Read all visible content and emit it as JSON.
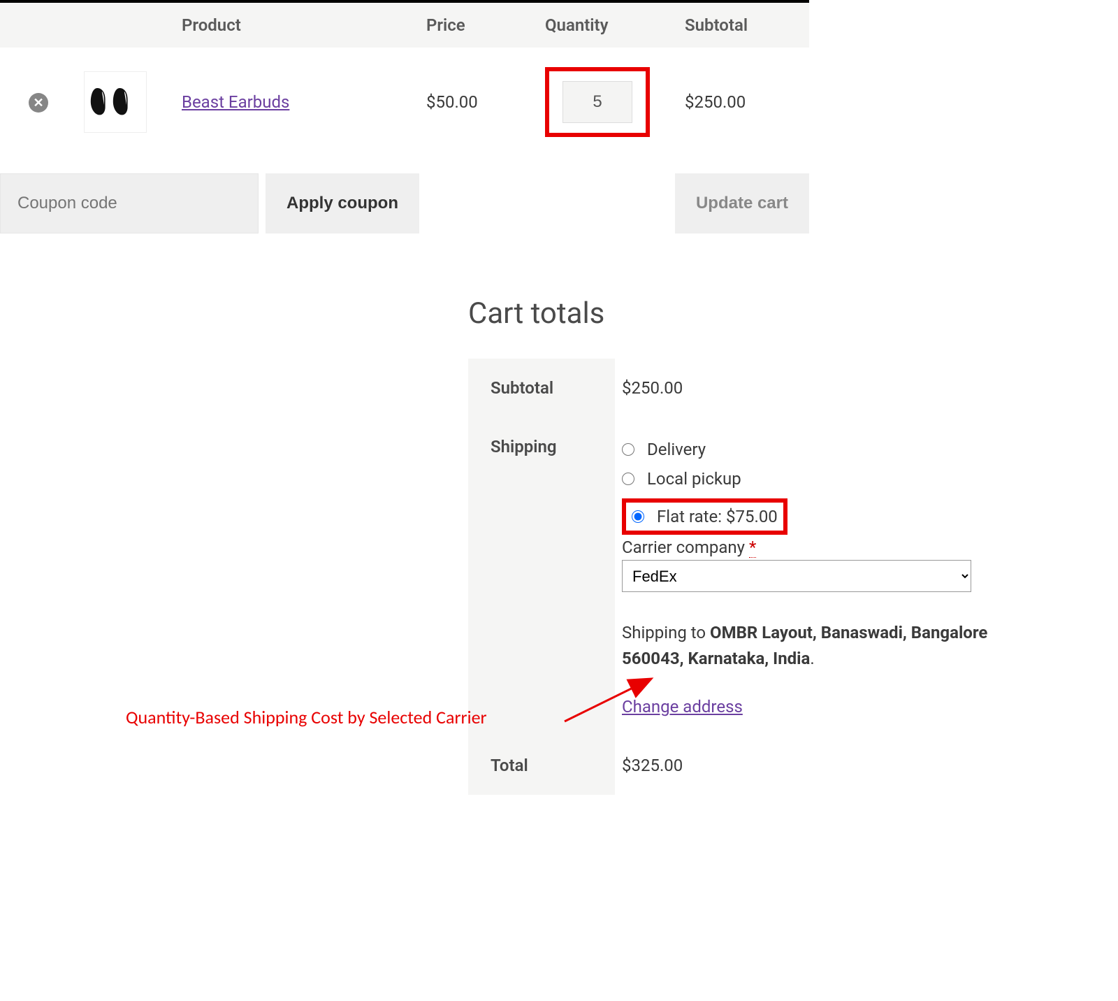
{
  "headers": {
    "product": "Product",
    "price": "Price",
    "qty": "Quantity",
    "sub": "Subtotal"
  },
  "item": {
    "remove": "✕",
    "name": "Beast Earbuds",
    "price": "$50.00",
    "qty": "5",
    "subtotal": "$250.00"
  },
  "actions": {
    "coupon_placeholder": "Coupon code",
    "apply": "Apply coupon",
    "update": "Update cart"
  },
  "totals_title": "Cart totals",
  "totals": {
    "subtotal_label": "Subtotal",
    "subtotal_value": "$250.00",
    "shipping_label": "Shipping",
    "opts": {
      "delivery": "Delivery",
      "pickup": "Local pickup",
      "flat": "Flat rate: $75.00"
    },
    "carrier_label": "Carrier company ",
    "carrier_req": "*",
    "carrier_value": "FedEx",
    "ship_to_prefix": "Shipping to ",
    "ship_to_addr": "OMBR Layout, Banaswadi, Bangalore 560043, Karnataka, India",
    "ship_to_suffix": ".",
    "change": "Change address",
    "total_label": "Total",
    "total_value": "$325.00"
  },
  "annotation": "Quantity-Based Shipping Cost by Selected Carrier"
}
